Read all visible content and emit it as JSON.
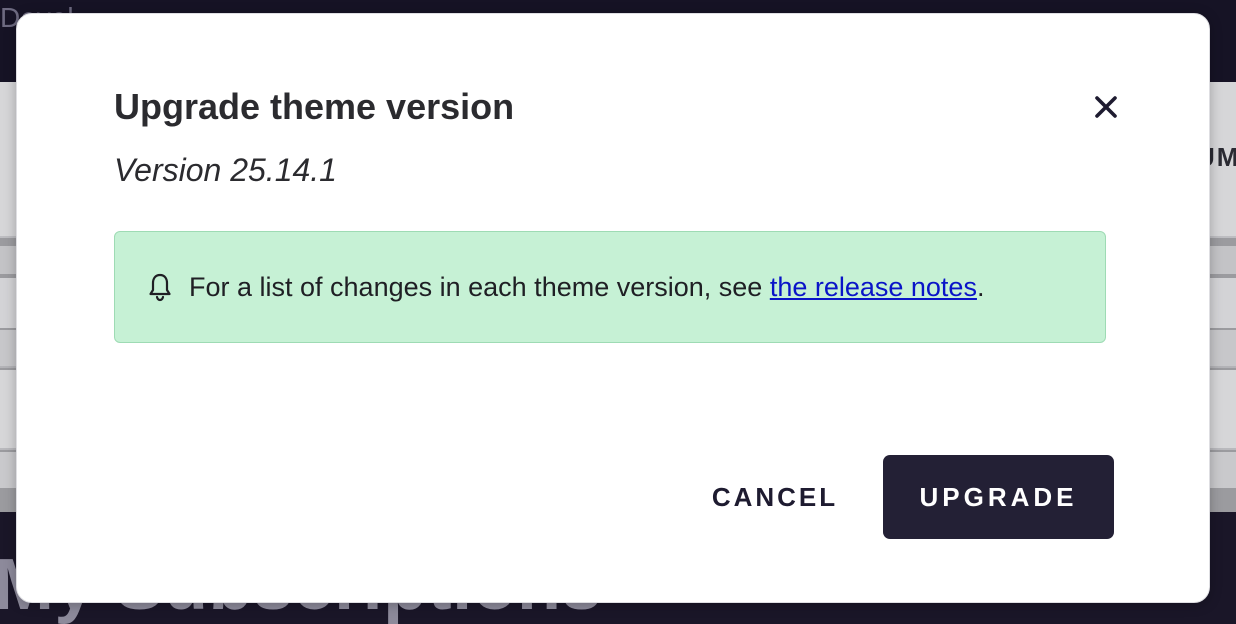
{
  "background": {
    "topbar_text": "Devel",
    "column_header": "UM",
    "section_heading": "My Subscriptions"
  },
  "dialog": {
    "title": "Upgrade theme version",
    "subtitle": "Version 25.14.1",
    "close_icon": "close-icon",
    "notice": {
      "icon": "bell-icon",
      "text_before": "For a list of changes in each theme version, see ",
      "link_text": "the release notes",
      "text_after": ".",
      "background_color": "#c6f1d5"
    },
    "cancel_label": "CANCEL",
    "upgrade_label": "UPGRADE",
    "primary_color": "#232035",
    "link_color": "#0a14c8"
  }
}
